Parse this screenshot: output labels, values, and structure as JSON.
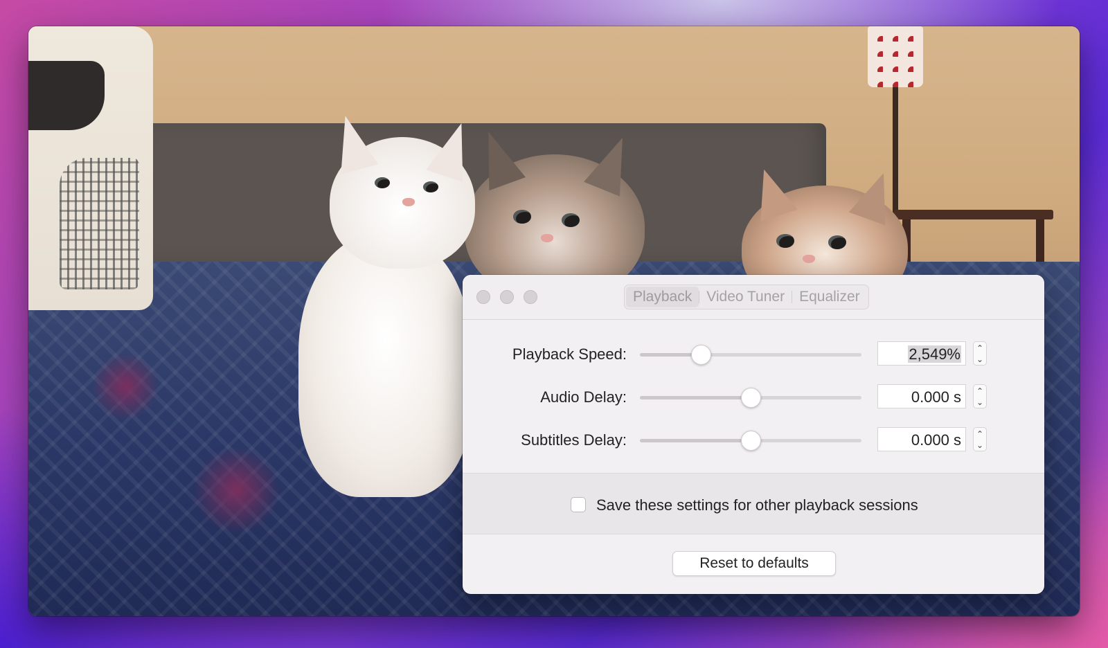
{
  "panel": {
    "tabs": [
      {
        "label": "Playback",
        "active": true
      },
      {
        "label": "Video Tuner",
        "active": false
      },
      {
        "label": "Equalizer",
        "active": false
      }
    ],
    "rows": [
      {
        "label": "Playback Speed:",
        "value": "2,549%",
        "slider_fraction": 0.275
      },
      {
        "label": "Audio Delay:",
        "value": "0.000 s",
        "slider_fraction": 0.5
      },
      {
        "label": "Subtitles Delay:",
        "value": "0.000 s",
        "slider_fraction": 0.5
      }
    ],
    "save_settings": {
      "label": "Save these settings for other playback sessions",
      "checked": false
    },
    "reset_label": "Reset to defaults"
  },
  "icons": {
    "stepper_up": "chevron-up-icon",
    "stepper_down": "chevron-down-icon"
  },
  "colors": {
    "panel_bg": "#f3f0f3",
    "desktop_accent": "#8a3fd0"
  }
}
